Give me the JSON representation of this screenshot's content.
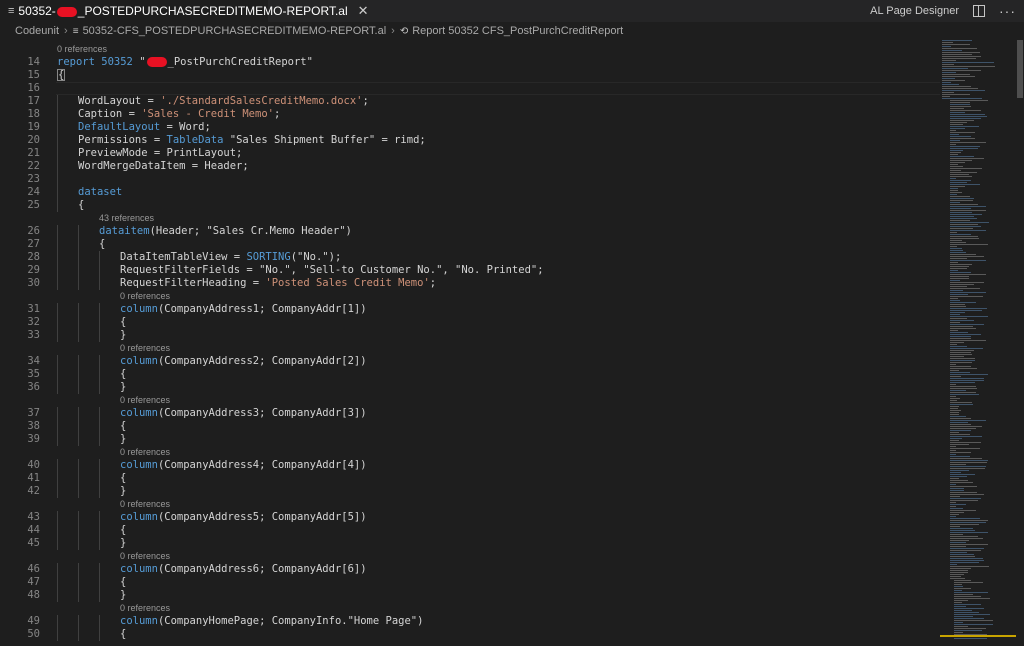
{
  "tab": {
    "title_prefix": "50352-",
    "title_suffix": "_POSTEDPURCHASECREDITMEMO-REPORT.al",
    "close": "✕",
    "icon": "list-icon"
  },
  "right_actions": {
    "ai_designer": "AL Page Designer",
    "split_icon": "split-editor-icon",
    "more": "···"
  },
  "breadcrumb": [
    "Codeunit",
    "50352-CFS_POSTEDPURCHASECREDITMEMO-REPORT.al",
    "Report 50352 CFS_PostPurchCreditReport"
  ],
  "code": [
    {
      "type": "lens",
      "text": "0 references",
      "indent": 0
    },
    {
      "type": "code",
      "num": "14",
      "indent": 0,
      "tokens": [
        [
          "k",
          "report "
        ],
        [
          "k",
          "50352 "
        ],
        [
          "t",
          "\""
        ],
        [
          "r",
          ""
        ],
        [
          "t",
          "_PostPurchCreditReport\""
        ]
      ]
    },
    {
      "type": "code",
      "num": "15",
      "indent": 0,
      "tokens": [
        [
          "t",
          "{"
        ]
      ],
      "brace": true
    },
    {
      "type": "code",
      "num": "16",
      "indent": 0,
      "tokens": []
    },
    {
      "type": "code",
      "num": "17",
      "indent": 1,
      "tokens": [
        [
          "t",
          "WordLayout = "
        ],
        [
          "s",
          "'./StandardSalesCreditMemo.docx'"
        ],
        [
          "t",
          ";"
        ]
      ]
    },
    {
      "type": "code",
      "num": "18",
      "indent": 1,
      "tokens": [
        [
          "t",
          "Caption = "
        ],
        [
          "s",
          "'Sales - Credit Memo'"
        ],
        [
          "t",
          ";"
        ]
      ]
    },
    {
      "type": "code",
      "num": "19",
      "indent": 1,
      "tokens": [
        [
          "k",
          "DefaultLayout"
        ],
        [
          "t",
          " = Word;"
        ]
      ]
    },
    {
      "type": "code",
      "num": "20",
      "indent": 1,
      "tokens": [
        [
          "t",
          "Permissions = "
        ],
        [
          "k",
          "TableData"
        ],
        [
          "t",
          " \"Sales Shipment Buffer\" = rimd;"
        ]
      ]
    },
    {
      "type": "code",
      "num": "21",
      "indent": 1,
      "tokens": [
        [
          "t",
          "PreviewMode = PrintLayout;"
        ]
      ]
    },
    {
      "type": "code",
      "num": "22",
      "indent": 1,
      "tokens": [
        [
          "t",
          "WordMergeDataItem = Header;"
        ]
      ]
    },
    {
      "type": "code",
      "num": "23",
      "indent": 1,
      "tokens": []
    },
    {
      "type": "code",
      "num": "24",
      "indent": 1,
      "tokens": [
        [
          "k",
          "dataset"
        ]
      ]
    },
    {
      "type": "code",
      "num": "25",
      "indent": 1,
      "tokens": [
        [
          "t",
          "{"
        ]
      ]
    },
    {
      "type": "lens",
      "text": "43 references",
      "indent": 2
    },
    {
      "type": "code",
      "num": "26",
      "indent": 2,
      "tokens": [
        [
          "k",
          "dataitem"
        ],
        [
          "t",
          "(Header; \"Sales Cr.Memo Header\")"
        ]
      ]
    },
    {
      "type": "code",
      "num": "27",
      "indent": 2,
      "tokens": [
        [
          "t",
          "{"
        ]
      ]
    },
    {
      "type": "code",
      "num": "28",
      "indent": 3,
      "tokens": [
        [
          "t",
          "DataItemTableView = "
        ],
        [
          "k",
          "SORTING"
        ],
        [
          "t",
          "(\"No.\");"
        ]
      ]
    },
    {
      "type": "code",
      "num": "29",
      "indent": 3,
      "tokens": [
        [
          "t",
          "RequestFilterFields = \"No.\", \"Sell-to Customer No.\", \"No. Printed\";"
        ]
      ]
    },
    {
      "type": "code",
      "num": "30",
      "indent": 3,
      "tokens": [
        [
          "t",
          "RequestFilterHeading = "
        ],
        [
          "s",
          "'Posted Sales Credit Memo'"
        ],
        [
          "t",
          ";"
        ]
      ]
    },
    {
      "type": "lens",
      "text": "0 references",
      "indent": 3
    },
    {
      "type": "code",
      "num": "31",
      "indent": 3,
      "tokens": [
        [
          "k",
          "column"
        ],
        [
          "t",
          "(CompanyAddress1; CompanyAddr[1])"
        ]
      ]
    },
    {
      "type": "code",
      "num": "32",
      "indent": 3,
      "tokens": [
        [
          "t",
          "{"
        ]
      ]
    },
    {
      "type": "code",
      "num": "33",
      "indent": 3,
      "tokens": [
        [
          "t",
          "}"
        ]
      ]
    },
    {
      "type": "lens",
      "text": "0 references",
      "indent": 3
    },
    {
      "type": "code",
      "num": "34",
      "indent": 3,
      "tokens": [
        [
          "k",
          "column"
        ],
        [
          "t",
          "(CompanyAddress2; CompanyAddr[2])"
        ]
      ]
    },
    {
      "type": "code",
      "num": "35",
      "indent": 3,
      "tokens": [
        [
          "t",
          "{"
        ]
      ]
    },
    {
      "type": "code",
      "num": "36",
      "indent": 3,
      "tokens": [
        [
          "t",
          "}"
        ]
      ]
    },
    {
      "type": "lens",
      "text": "0 references",
      "indent": 3
    },
    {
      "type": "code",
      "num": "37",
      "indent": 3,
      "tokens": [
        [
          "k",
          "column"
        ],
        [
          "t",
          "(CompanyAddress3; CompanyAddr[3])"
        ]
      ]
    },
    {
      "type": "code",
      "num": "38",
      "indent": 3,
      "tokens": [
        [
          "t",
          "{"
        ]
      ]
    },
    {
      "type": "code",
      "num": "39",
      "indent": 3,
      "tokens": [
        [
          "t",
          "}"
        ]
      ]
    },
    {
      "type": "lens",
      "text": "0 references",
      "indent": 3
    },
    {
      "type": "code",
      "num": "40",
      "indent": 3,
      "tokens": [
        [
          "k",
          "column"
        ],
        [
          "t",
          "(CompanyAddress4; CompanyAddr[4])"
        ]
      ]
    },
    {
      "type": "code",
      "num": "41",
      "indent": 3,
      "tokens": [
        [
          "t",
          "{"
        ]
      ]
    },
    {
      "type": "code",
      "num": "42",
      "indent": 3,
      "tokens": [
        [
          "t",
          "}"
        ]
      ]
    },
    {
      "type": "lens",
      "text": "0 references",
      "indent": 3
    },
    {
      "type": "code",
      "num": "43",
      "indent": 3,
      "tokens": [
        [
          "k",
          "column"
        ],
        [
          "t",
          "(CompanyAddress5; CompanyAddr[5])"
        ]
      ]
    },
    {
      "type": "code",
      "num": "44",
      "indent": 3,
      "tokens": [
        [
          "t",
          "{"
        ]
      ]
    },
    {
      "type": "code",
      "num": "45",
      "indent": 3,
      "tokens": [
        [
          "t",
          "}"
        ]
      ]
    },
    {
      "type": "lens",
      "text": "0 references",
      "indent": 3
    },
    {
      "type": "code",
      "num": "46",
      "indent": 3,
      "tokens": [
        [
          "k",
          "column"
        ],
        [
          "t",
          "(CompanyAddress6; CompanyAddr[6])"
        ]
      ]
    },
    {
      "type": "code",
      "num": "47",
      "indent": 3,
      "tokens": [
        [
          "t",
          "{"
        ]
      ]
    },
    {
      "type": "code",
      "num": "48",
      "indent": 3,
      "tokens": [
        [
          "t",
          "}"
        ]
      ]
    },
    {
      "type": "lens",
      "text": "0 references",
      "indent": 3
    },
    {
      "type": "code",
      "num": "49",
      "indent": 3,
      "tokens": [
        [
          "k",
          "column"
        ],
        [
          "t",
          "(CompanyHomePage; CompanyInfo.\"Home Page\")"
        ]
      ]
    },
    {
      "type": "code",
      "num": "50",
      "indent": 3,
      "tokens": [
        [
          "t",
          "{"
        ]
      ]
    }
  ]
}
